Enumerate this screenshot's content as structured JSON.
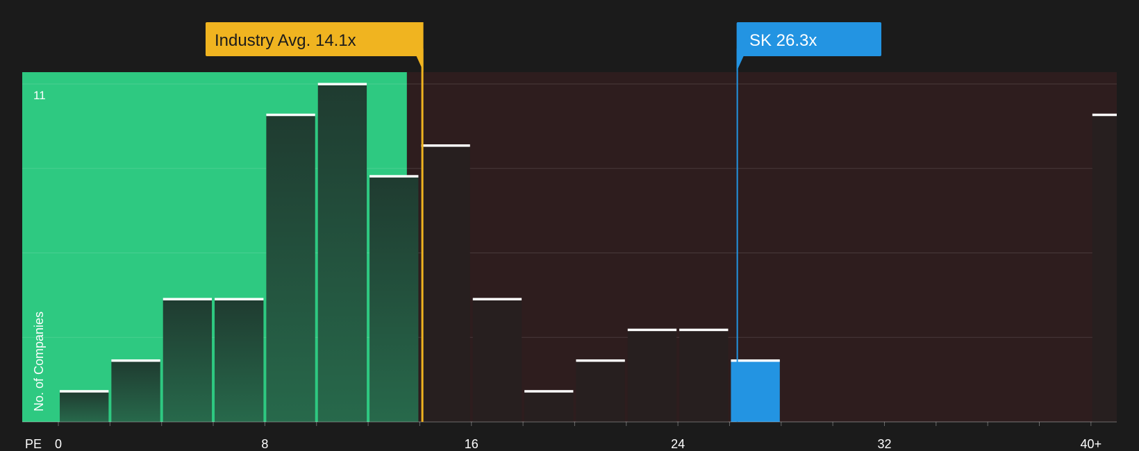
{
  "chart_data": {
    "type": "bar",
    "xlabel": "PE",
    "ylabel": "No. of Companies",
    "x_ticks": [
      {
        "value": 0,
        "label": "0"
      },
      {
        "value": 8,
        "label": "8"
      },
      {
        "value": 16,
        "label": "16"
      },
      {
        "value": 24,
        "label": "24"
      },
      {
        "value": 32,
        "label": "32"
      },
      {
        "value": 40,
        "label": "40+"
      }
    ],
    "xlim": [
      -1.4,
      41.0
    ],
    "ylim": [
      0,
      11.4
    ],
    "y_max_label": "11",
    "grid": true,
    "bin_width": 2,
    "bins": [
      {
        "start": 0,
        "count": 1
      },
      {
        "start": 2,
        "count": 2
      },
      {
        "start": 4,
        "count": 4
      },
      {
        "start": 6,
        "count": 4
      },
      {
        "start": 8,
        "count": 10
      },
      {
        "start": 10,
        "count": 11
      },
      {
        "start": 12,
        "count": 8
      },
      {
        "start": 14,
        "count": 9
      },
      {
        "start": 16,
        "count": 4
      },
      {
        "start": 18,
        "count": 1
      },
      {
        "start": 20,
        "count": 2
      },
      {
        "start": 22,
        "count": 3
      },
      {
        "start": 24,
        "count": 3
      },
      {
        "start": 26,
        "count": 2,
        "highlight": true
      },
      {
        "start": 40,
        "count": 10
      }
    ],
    "fair_region_end": 13.5,
    "industry_avg": {
      "value": 14.1,
      "label": "Industry Avg. 14.1x"
    },
    "company": {
      "value": 26.3,
      "label": "SK 26.3x"
    },
    "colors": {
      "background": "#1b1b1b",
      "fair_zone": "#2ec981",
      "expensive_zone": "#2e1d1e",
      "bar_in_fair": "#1f3f33",
      "bar_default": "#271f1f",
      "bar_highlight": "#2394e2",
      "industry_accent": "#f0b420",
      "company_accent": "#2394e2",
      "bar_cap": "#ffffff"
    }
  }
}
